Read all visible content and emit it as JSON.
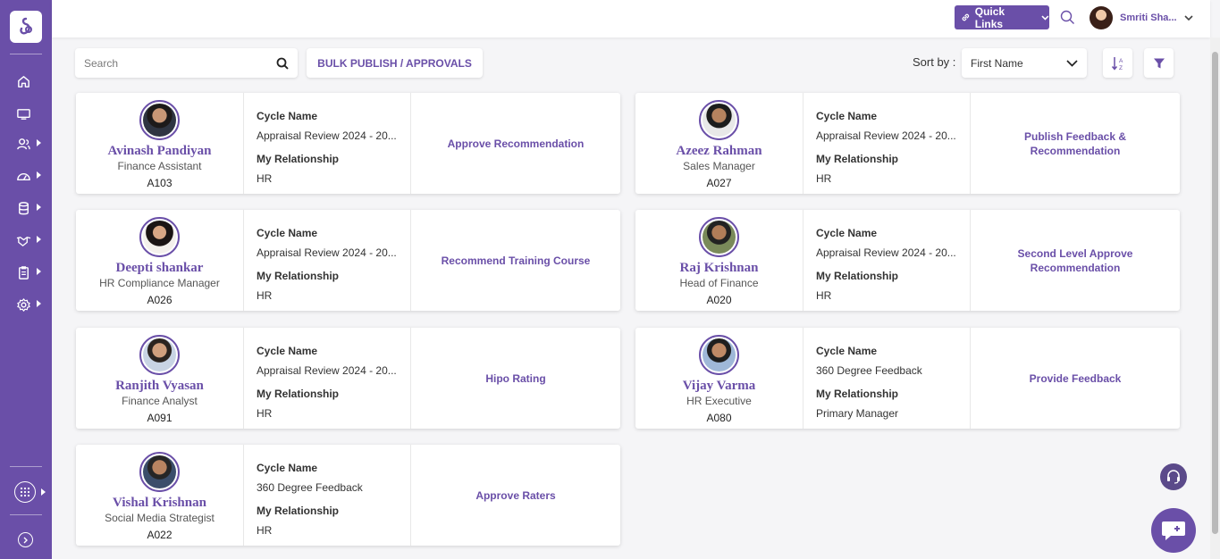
{
  "sidebar": {
    "items": [
      {
        "icon": "home-icon",
        "has_submenu": false
      },
      {
        "icon": "monitor-icon",
        "has_submenu": false
      },
      {
        "icon": "users-icon",
        "has_submenu": true
      },
      {
        "icon": "gauge-icon",
        "has_submenu": true
      },
      {
        "icon": "database-icon",
        "has_submenu": true
      },
      {
        "icon": "handshake-icon",
        "has_submenu": true
      },
      {
        "icon": "clipboard-icon",
        "has_submenu": true
      },
      {
        "icon": "settings-icon",
        "has_submenu": true
      }
    ]
  },
  "header": {
    "quick_links_label": "Quick Links",
    "user_name": "Smriti Sha..."
  },
  "toolbar": {
    "search_placeholder": "Search",
    "bulk_label": "BULK PUBLISH / APPROVALS",
    "sort_label": "Sort by :",
    "sort_value": "First Name"
  },
  "labels": {
    "cycle": "Cycle Name",
    "relationship": "My Relationship"
  },
  "colors": {
    "brand": "#6a4fa8",
    "background": "#f5f5f7"
  },
  "cards": [
    {
      "name": "Avinash Pandiyan",
      "role": "Finance Assistant",
      "id": "A103",
      "cycle": "Appraisal Review 2024 - 20...",
      "relationship": "HR",
      "action": "Approve Recommendation"
    },
    {
      "name": "Azeez Rahman",
      "role": "Sales Manager",
      "id": "A027",
      "cycle": "Appraisal Review 2024 - 20...",
      "relationship": "HR",
      "action": "Publish Feedback & Recommendation"
    },
    {
      "name": "Deepti shankar",
      "role": "HR Compliance Manager",
      "id": "A026",
      "cycle": "Appraisal Review 2024 - 20...",
      "relationship": "HR",
      "action": "Recommend Training Course"
    },
    {
      "name": "Raj Krishnan",
      "role": "Head of Finance",
      "id": "A020",
      "cycle": "Appraisal Review 2024 - 20...",
      "relationship": "HR",
      "action": "Second Level Approve Recommendation"
    },
    {
      "name": "Ranjith Vyasan",
      "role": "Finance Analyst",
      "id": "A091",
      "cycle": "Appraisal Review 2024 - 20...",
      "relationship": "HR",
      "action": "Hipo Rating"
    },
    {
      "name": "Vijay Varma",
      "role": "HR Executive",
      "id": "A080",
      "cycle": "360 Degree Feedback",
      "relationship": "Primary Manager",
      "action": "Provide Feedback"
    },
    {
      "name": "Vishal Krishnan",
      "role": "Social Media Strategist",
      "id": "A022",
      "cycle": "360 Degree Feedback",
      "relationship": "HR",
      "action": "Approve Raters"
    }
  ]
}
